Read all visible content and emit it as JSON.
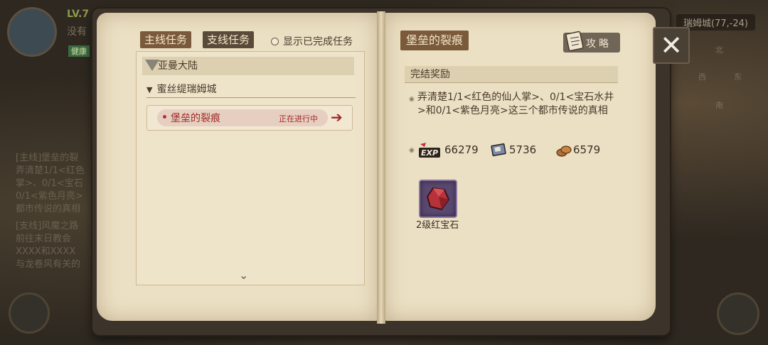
{
  "hud": {
    "level": "LV.7",
    "status_prefix": "没有",
    "tag": "健康",
    "coords": "瑞姆城(77,-24)",
    "compass": {
      "north": "北",
      "west": "西",
      "east": "东",
      "south": "南"
    },
    "log_lines": [
      "[主线]堡垒的裂",
      "弄清楚1/1<红色",
      "掌>、0/1<宝石",
      "0/1<紫色月亮>",
      "都市传说的真相",
      "[支线]风魔之路",
      "前往末日教会",
      "XXXX和XXXX",
      "与龙卷风有关的"
    ]
  },
  "left_page": {
    "tabs": {
      "main": "主线任务",
      "side": "支线任务"
    },
    "show_completed_label": "显示已完成任务",
    "region": "亚曼大陆",
    "city": "蜜丝缇瑞姆城",
    "quests": [
      {
        "name": "堡垒的裂痕",
        "status": "正在进行中"
      }
    ],
    "scroll_glyph": "⌄"
  },
  "right_page": {
    "title": "堡垒的裂痕",
    "guide_label": "攻略",
    "rewards_header": "完结奖励",
    "description": "弄清楚1/1<红色的仙人掌>、0/1<宝石水井>和0/1<紫色月亮>这三个都市传说的真相",
    "rewards": {
      "exp": "66279",
      "card": "5736",
      "coin": "6579"
    },
    "item": {
      "name": "2级红宝石"
    }
  },
  "close_glyph": "✕",
  "colors": {
    "accent": "#7a5a3a",
    "active_quest": "#a02a2a",
    "page": "#ece0c4"
  }
}
